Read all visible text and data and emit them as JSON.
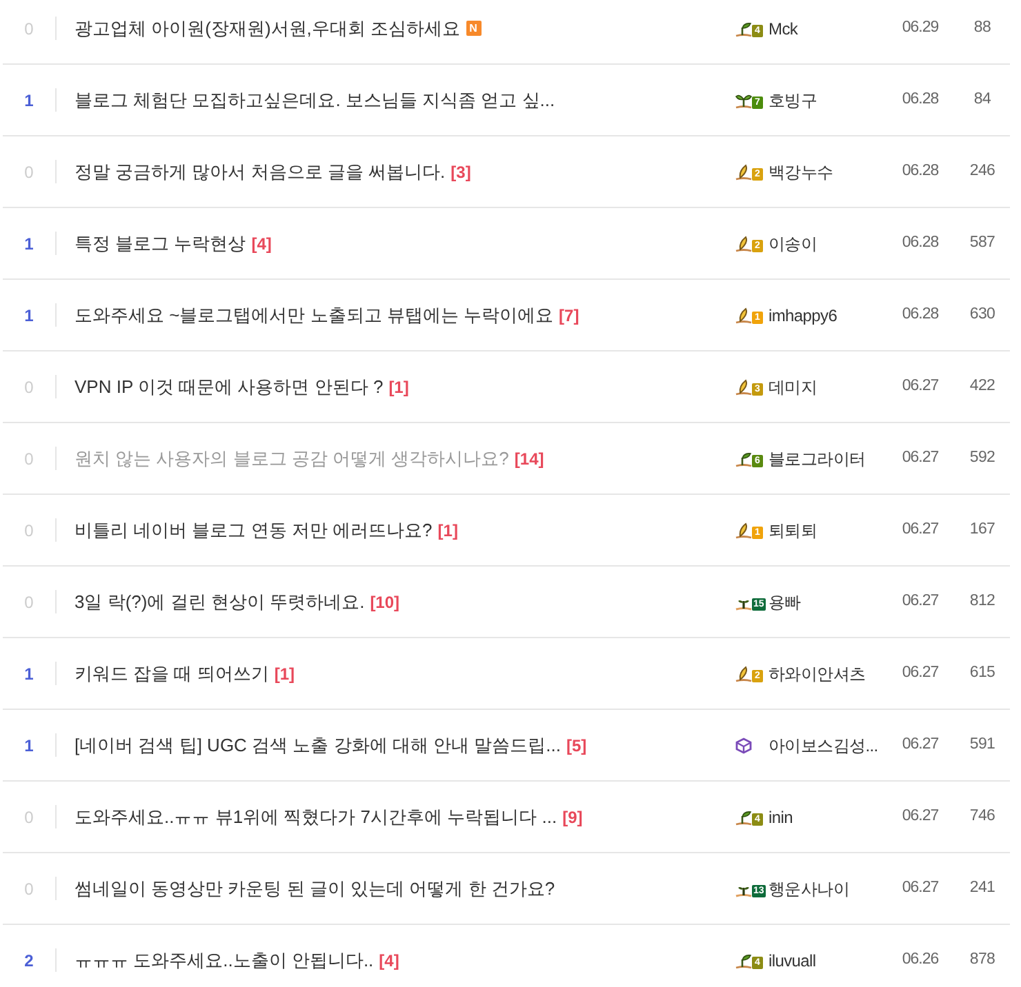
{
  "rows": [
    {
      "likes": "0",
      "highlight": false,
      "title": "광고업체 아이원(장재원)서원,우대회 조심하세요",
      "badge": "N",
      "visited": false,
      "author": {
        "name": "Mck",
        "kind": "sprout",
        "level": "4",
        "color": "#8c8c14"
      },
      "date": "06.29",
      "views": "88"
    },
    {
      "likes": "1",
      "highlight": true,
      "title": "블로그 체험단 모집하고싶은데요. 보스님들 지식좀 얻고 싶...",
      "visited": false,
      "author": {
        "name": "호빙구",
        "kind": "two_leaf",
        "level": "7",
        "color": "#4c8c0c"
      },
      "date": "06.28",
      "views": "84"
    },
    {
      "likes": "0",
      "highlight": false,
      "title": "정말 궁금하게 많아서 처음으로 글을 써봅니다.",
      "comments": "[3]",
      "visited": false,
      "author": {
        "name": "백강누수",
        "kind": "seed",
        "level": "2",
        "color": "#d9a20f"
      },
      "date": "06.28",
      "views": "246"
    },
    {
      "likes": "1",
      "highlight": true,
      "title": "특정 블로그 누락현상",
      "comments": "[4]",
      "visited": false,
      "author": {
        "name": "이송이",
        "kind": "seed",
        "level": "2",
        "color": "#d9a20f"
      },
      "date": "06.28",
      "views": "587"
    },
    {
      "likes": "1",
      "highlight": true,
      "title": "도와주세요 ~블로그탭에서만 노출되고 뷰탭에는 누락이에요",
      "comments": "[7]",
      "visited": false,
      "author": {
        "name": "imhappy6",
        "kind": "seed",
        "level": "1",
        "color": "#f0a30a"
      },
      "date": "06.28",
      "views": "630"
    },
    {
      "likes": "0",
      "highlight": false,
      "title": "VPN IP 이것 때문에 사용하면 안된다 ?",
      "comments": "[1]",
      "visited": false,
      "author": {
        "name": "데미지",
        "kind": "seed",
        "level": "3",
        "color": "#c49a0e"
      },
      "date": "06.27",
      "views": "422"
    },
    {
      "likes": "0",
      "highlight": false,
      "title": "원치 않는 사용자의 블로그 공감 어떻게 생각하시나요?",
      "comments": "[14]",
      "visited": true,
      "author": {
        "name": "블로그라이터",
        "kind": "sprout",
        "level": "6",
        "color": "#5a8a10"
      },
      "date": "06.27",
      "views": "592"
    },
    {
      "likes": "0",
      "highlight": false,
      "title": "비틀리 네이버 블로그 연동 저만 에러뜨나요?",
      "comments": "[1]",
      "visited": false,
      "author": {
        "name": "퇴퇴퇴",
        "kind": "seed",
        "level": "1",
        "color": "#f0a30a"
      },
      "date": "06.27",
      "views": "167"
    },
    {
      "likes": "0",
      "highlight": false,
      "title": "3일 락(?)에 걸린 현상이 뚜렷하네요.",
      "comments": "[10]",
      "visited": false,
      "author": {
        "name": "용빠",
        "kind": "seedling",
        "level": "15",
        "color": "#0e6b3a"
      },
      "date": "06.27",
      "views": "812"
    },
    {
      "likes": "1",
      "highlight": true,
      "title": "키워드 잡을 때 띄어쓰기",
      "comments": "[1]",
      "visited": false,
      "author": {
        "name": "하와이안셔츠",
        "kind": "seed",
        "level": "2",
        "color": "#d9a20f"
      },
      "date": "06.27",
      "views": "615"
    },
    {
      "likes": "1",
      "highlight": true,
      "title": "[네이버 검색 팁] UGC 검색 노출 강화에 대해 안내 말씀드립...",
      "comments": "[5]",
      "visited": false,
      "author": {
        "name": "아이보스김성...",
        "kind": "shield"
      },
      "date": "06.27",
      "views": "591"
    },
    {
      "likes": "0",
      "highlight": false,
      "title": "도와주세요..ㅠㅠ 뷰1위에 찍혔다가 7시간후에 누락됩니다 ...",
      "comments": "[9]",
      "visited": false,
      "author": {
        "name": "inin",
        "kind": "sprout",
        "level": "4",
        "color": "#8c8c14"
      },
      "date": "06.27",
      "views": "746"
    },
    {
      "likes": "0",
      "highlight": false,
      "title": "썸네일이 동영상만 카운팅 된 글이 있는데 어떻게 한 건가요?",
      "visited": false,
      "author": {
        "name": "행운사나이",
        "kind": "seedling",
        "level": "13",
        "color": "#0e6b3a"
      },
      "date": "06.27",
      "views": "241"
    },
    {
      "likes": "2",
      "highlight": true,
      "title": "ㅠㅠㅠ 도와주세요..노출이 안됩니다..",
      "comments": "[4]",
      "visited": false,
      "author": {
        "name": "iluvuall",
        "kind": "sprout",
        "level": "4",
        "color": "#8c8c14"
      },
      "date": "06.26",
      "views": "878"
    }
  ]
}
